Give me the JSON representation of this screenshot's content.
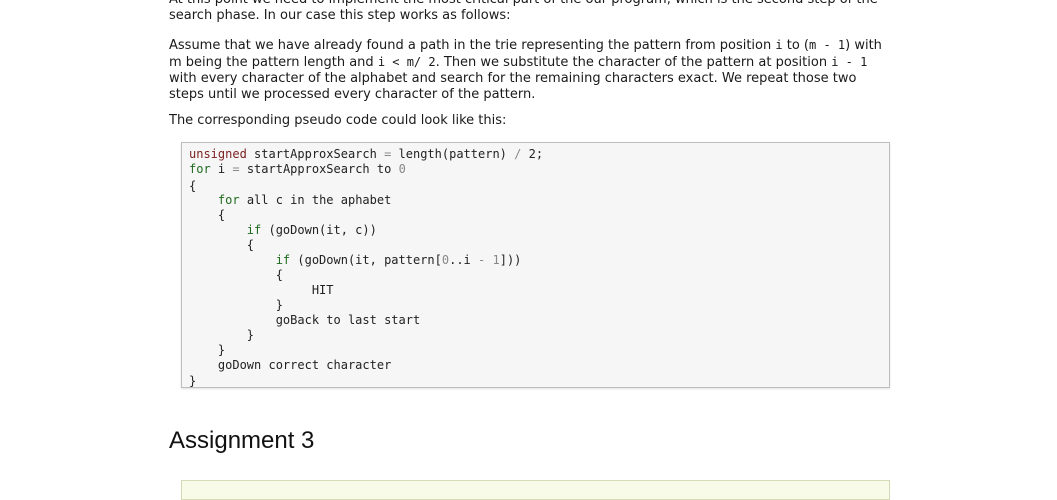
{
  "intro_clipped": "At this point we need to implement the most critical part of the our program, which is the second step of the",
  "intro_line2": "search phase. In our case this step works as follows:",
  "para": {
    "l1a": "Assume that we have already found a path in the trie representing the pattern from position ",
    "l1_i": "i",
    "l1b": " to (",
    "l1_m1": "m - 1",
    "l1c": ") with",
    "l2a": "m being the pattern length and ",
    "l2_cond": "i < m/ 2",
    "l2b": ". Then we substitute the character of the pattern at position ",
    "l2_pos": "i - 1",
    "l3": "with every character of the alphabet and search for the remaining characters exact. We repeat those two",
    "l4": "steps until we processed every character of the pattern."
  },
  "pseudo_intro": "The corresponding pseudo code could look like this:",
  "code": [
    [
      {
        "t": "unsigned",
        "c": "kw"
      },
      {
        "t": " startApproxSearch "
      },
      {
        "t": "=",
        "c": "op"
      },
      {
        "t": " length(pattern) "
      },
      {
        "t": "/",
        "c": "op"
      },
      {
        "t": " 2;"
      }
    ],
    [
      {
        "t": "for",
        "c": "kw2"
      },
      {
        "t": " i "
      },
      {
        "t": "=",
        "c": "op"
      },
      {
        "t": " startApproxSearch to "
      },
      {
        "t": "0",
        "c": "num"
      }
    ],
    [
      {
        "t": "{"
      }
    ],
    [
      {
        "t": "    "
      },
      {
        "t": "for",
        "c": "kw2"
      },
      {
        "t": " all c in the aphabet"
      }
    ],
    [
      {
        "t": "    {"
      }
    ],
    [
      {
        "t": "        "
      },
      {
        "t": "if",
        "c": "kw2"
      },
      {
        "t": " (goDown(it, c))"
      }
    ],
    [
      {
        "t": "        {"
      }
    ],
    [
      {
        "t": "            "
      },
      {
        "t": "if",
        "c": "kw2"
      },
      {
        "t": " (goDown(it, pattern["
      },
      {
        "t": "0",
        "c": "num"
      },
      {
        "t": "..i "
      },
      {
        "t": "-",
        "c": "op"
      },
      {
        "t": " "
      },
      {
        "t": "1",
        "c": "num"
      },
      {
        "t": "]))"
      }
    ],
    [
      {
        "t": "            {"
      }
    ],
    [
      {
        "t": "                 HIT"
      }
    ],
    [
      {
        "t": "            }"
      }
    ],
    [
      {
        "t": "            goBack to last start"
      }
    ],
    [
      {
        "t": "        }"
      }
    ],
    [
      {
        "t": "    }"
      }
    ],
    [
      {
        "t": "    goDown correct character"
      }
    ],
    [
      {
        "t": "}"
      }
    ]
  ],
  "heading": "Assignment 3"
}
